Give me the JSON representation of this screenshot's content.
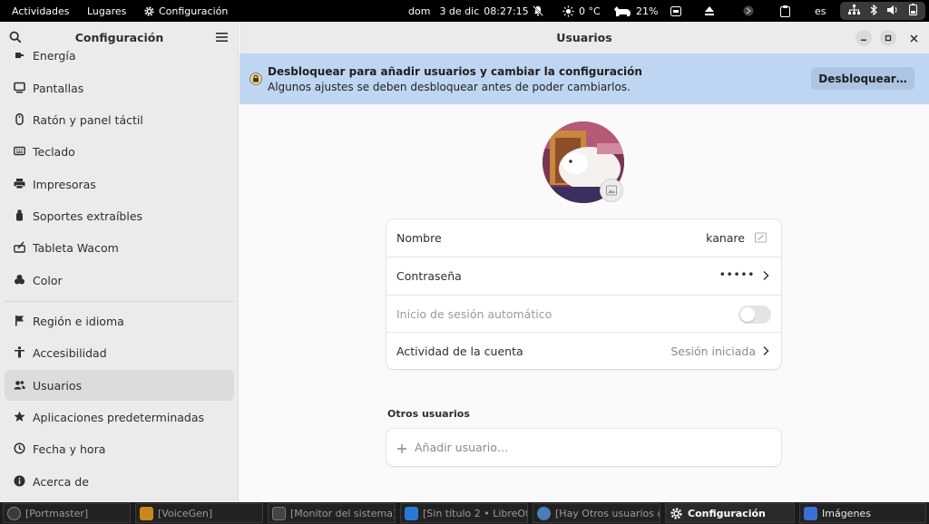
{
  "topbar": {
    "activities": "Actividades",
    "places": "Lugares",
    "app_menu": "Configuración",
    "day": "dom",
    "date": "3 de dic",
    "time": "08:27:15",
    "temperature": "0 °C",
    "battery": "21%",
    "keyboard_layout": "es"
  },
  "sidebar": {
    "title": "Configuración",
    "items": [
      {
        "label": "Energía",
        "icon": "power-plug-icon"
      },
      {
        "label": "Pantallas",
        "icon": "display-icon"
      },
      {
        "label": "Ratón y panel táctil",
        "icon": "mouse-icon"
      },
      {
        "label": "Teclado",
        "icon": "keyboard-icon"
      },
      {
        "label": "Impresoras",
        "icon": "printer-icon"
      },
      {
        "label": "Soportes extraíbles",
        "icon": "usb-icon"
      },
      {
        "label": "Tableta Wacom",
        "icon": "tablet-icon"
      },
      {
        "label": "Color",
        "icon": "color-icon"
      },
      {
        "label": "Región e idioma",
        "icon": "flag-icon"
      },
      {
        "label": "Accesibilidad",
        "icon": "accessibility-icon"
      },
      {
        "label": "Usuarios",
        "icon": "users-icon"
      },
      {
        "label": "Aplicaciones predeterminadas",
        "icon": "star-icon"
      },
      {
        "label": "Fecha y hora",
        "icon": "clock-icon"
      },
      {
        "label": "Acerca de",
        "icon": "info-icon"
      }
    ],
    "selected": "Usuarios"
  },
  "main": {
    "title": "Usuarios",
    "banner": {
      "title": "Desbloquear para añadir usuarios y cambiar la configuración",
      "subtitle": "Algunos ajustes se deben desbloquear antes de poder cambiarlos.",
      "button": "Desbloquear…"
    },
    "account": {
      "name_label": "Nombre",
      "name_value": "kanare",
      "password_label": "Contraseña",
      "password_value": "•••••",
      "autologin_label": "Inicio de sesión automático",
      "autologin_enabled": false,
      "activity_label": "Actividad de la cuenta",
      "activity_value": "Sesión iniciada"
    },
    "others": {
      "title": "Otros usuarios",
      "add_label": "Añadir usuario…"
    }
  },
  "taskbar": {
    "tasks": [
      {
        "label": "[Portmaster]",
        "color": "#3a3a3a"
      },
      {
        "label": "[VoiceGen]",
        "color": "#c78a1a"
      },
      {
        "label": "[Monitor del sistema]",
        "color": "#444444"
      },
      {
        "label": "[Sin título 2 • LibreOf…",
        "color": "#2a78d6"
      },
      {
        "label": "[Hay Otros usuarios c…",
        "color": "#4a7fb5"
      },
      {
        "label": "Configuración",
        "color": "#555555",
        "active": true
      },
      {
        "label": "Imágenes",
        "color": "#3b6fd1"
      }
    ]
  },
  "colors": {
    "banner_bg": "#bfd6f2",
    "sidebar_bg": "#ebebeb",
    "content_bg": "#fafafa"
  }
}
